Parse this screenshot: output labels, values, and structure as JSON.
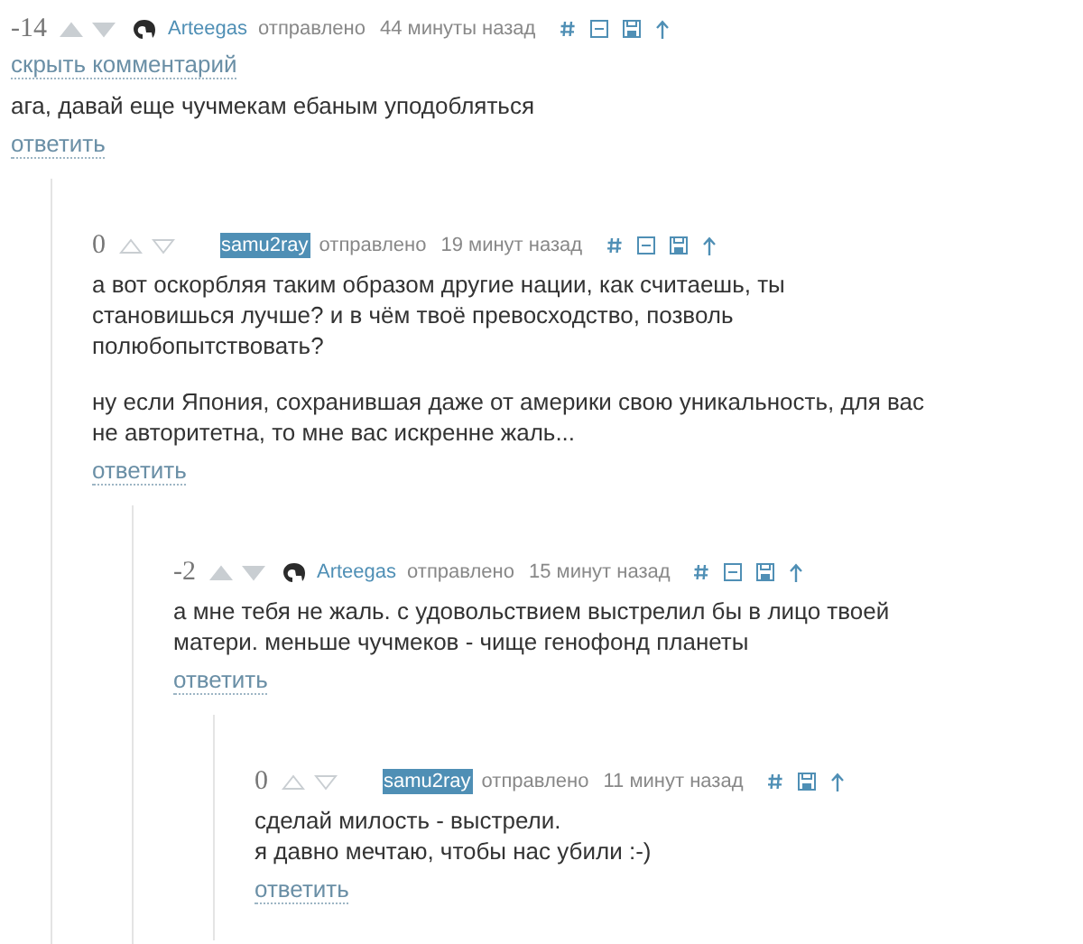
{
  "comments": [
    {
      "rating": "-14",
      "voted": true,
      "author": "Arteegas",
      "author_highlighted": false,
      "has_avatar": true,
      "sent": "отправлено",
      "time": "44 минуты назад",
      "tools": [
        {
          "kind": "hash"
        },
        {
          "kind": "collapse"
        },
        {
          "kind": "save"
        },
        {
          "kind": "up"
        }
      ],
      "hide_link": "скрыть комментарий",
      "paragraphs": [
        [
          "ага, давай еще чучмекам ебаным уподобляться"
        ]
      ],
      "reply": "ответить",
      "children": [
        {
          "rating": "0",
          "voted": false,
          "author": "samu2ray",
          "author_highlighted": true,
          "has_avatar": false,
          "sent": "отправлено",
          "time": "19 минут назад",
          "tools": [
            {
              "kind": "hash"
            },
            {
              "kind": "collapse"
            },
            {
              "kind": "save"
            },
            {
              "kind": "up"
            }
          ],
          "paragraphs": [
            [
              "а вот оскорбляя таким образом другие нации, как считаешь, ты",
              "становишься лучше? и в чём твоё превосходство, позволь",
              "полюбопытствовать?"
            ],
            [
              "ну если Япония, сохранившая даже от америки свою уникальность, для вас",
              "не авторитетна, то мне вас искренне жаль..."
            ]
          ],
          "reply": "ответить",
          "children": [
            {
              "rating": "-2",
              "voted": true,
              "author": "Arteegas",
              "author_highlighted": false,
              "has_avatar": true,
              "sent": "отправлено",
              "time": "15 минут назад",
              "tools": [
                {
                  "kind": "hash"
                },
                {
                  "kind": "collapse"
                },
                {
                  "kind": "save"
                },
                {
                  "kind": "up"
                }
              ],
              "paragraphs": [
                [
                  "а мне тебя не жаль. с удовольствием выстрелил бы в лицо твоей",
                  "матери. меньше чучмеков - чище генофонд планеты"
                ]
              ],
              "reply": "ответить",
              "children": [
                {
                  "rating": "0",
                  "voted": false,
                  "author": "samu2ray",
                  "author_highlighted": true,
                  "has_avatar": false,
                  "sent": "отправлено",
                  "time": "11 минут назад",
                  "tools": [
                    {
                      "kind": "hash"
                    },
                    {
                      "kind": "save"
                    },
                    {
                      "kind": "up"
                    }
                  ],
                  "paragraphs": [
                    [
                      "сделай милость - выстрели.",
                      "я давно мечтаю, чтобы нас убили :-)"
                    ]
                  ],
                  "reply": "ответить"
                }
              ]
            }
          ]
        }
      ]
    }
  ]
}
